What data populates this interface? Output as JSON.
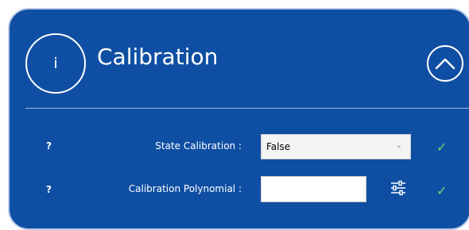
{
  "panel": {
    "info_icon_glyph": "i",
    "title": "Calibration",
    "collapse_icon": "chevron-up-icon"
  },
  "rows": [
    {
      "help": "?",
      "label": "State Calibration :",
      "control": "select",
      "value": "False",
      "valid_icon": "check-icon"
    },
    {
      "help": "?",
      "label": "Calibration Polynomial :",
      "control": "text",
      "value": "",
      "settings_icon": "sliders-icon",
      "valid_icon": "check-icon"
    }
  ],
  "colors": {
    "panel_bg": "#0f4fa3",
    "text": "#ffffff",
    "check": "#6fd86f"
  }
}
